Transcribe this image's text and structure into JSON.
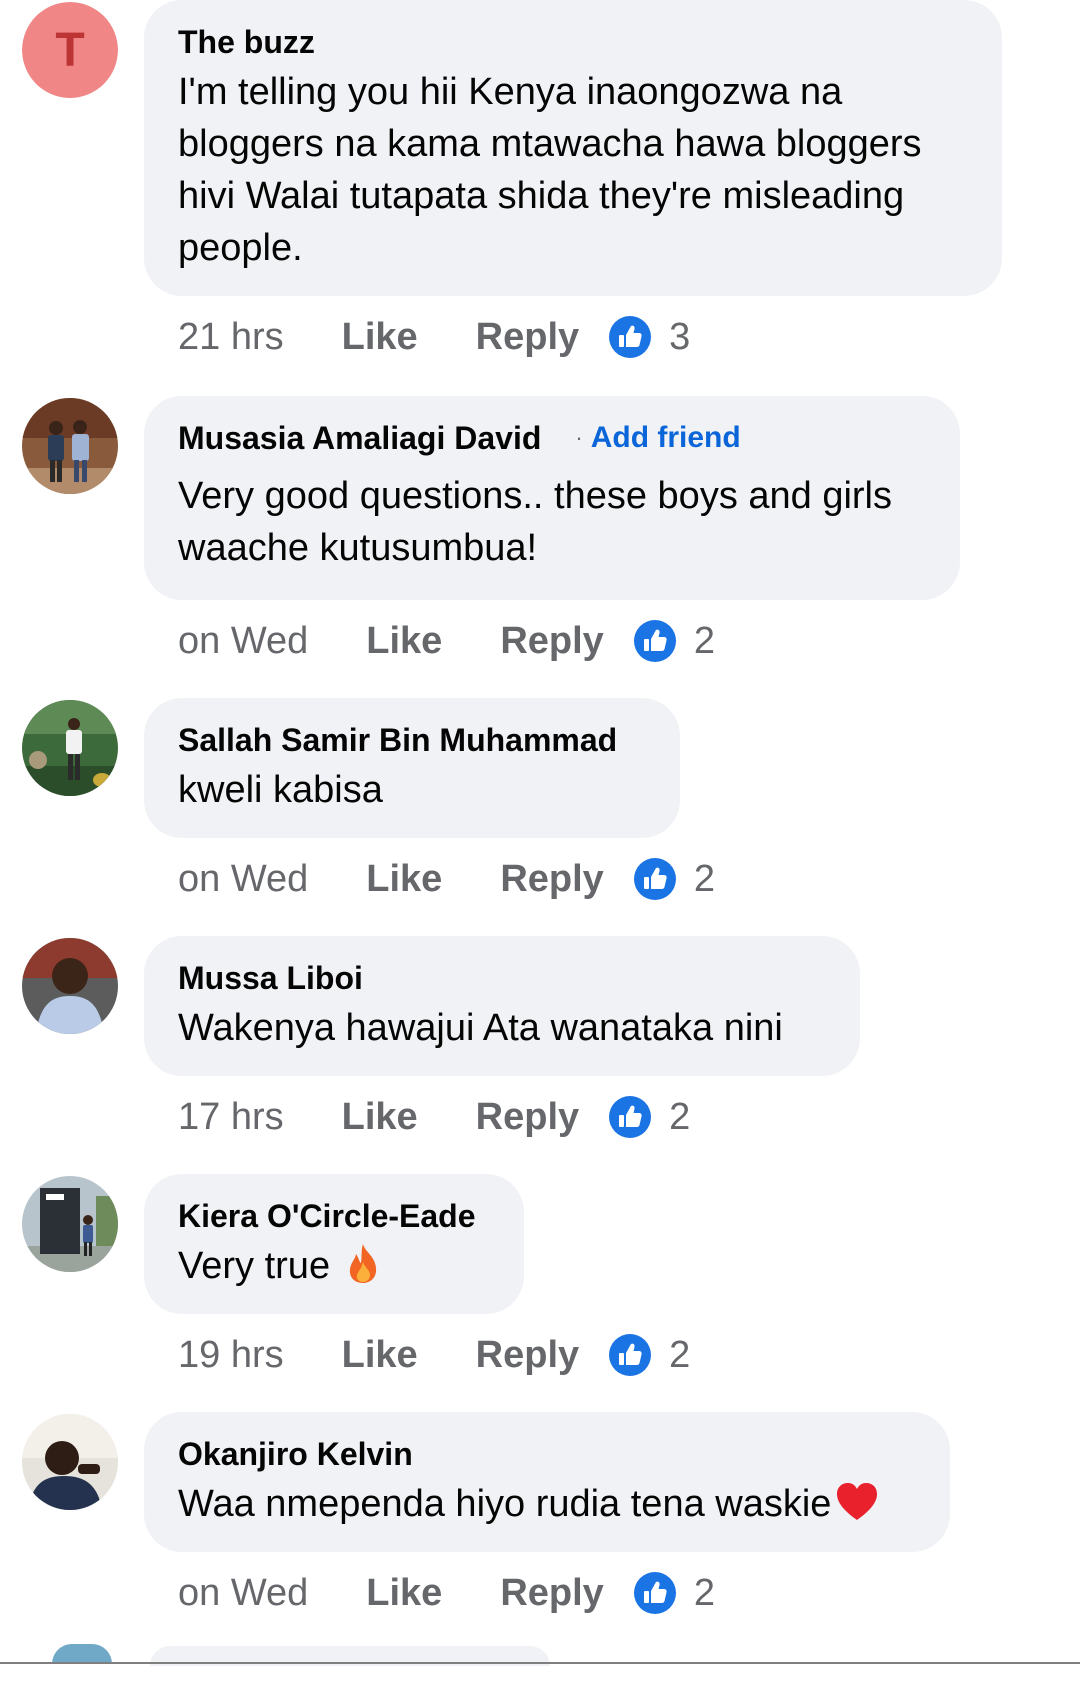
{
  "comments": [
    {
      "avatar": {
        "type": "letter",
        "letter": "T",
        "bg": "#f08686"
      },
      "author": "The buzz",
      "text": "I'm telling you hii Kenya inaongozwa na\nbloggers na kama mtawacha hawa bloggers\nhivi Walai tutapata shida they're misleading\npeople.",
      "time": "21 hrs",
      "like": "Like",
      "reply": "Reply",
      "reactions": "3"
    },
    {
      "avatar": {
        "type": "photo",
        "icon": "two-men-standing-photo"
      },
      "author": "Musasia Amaliagi David",
      "separator": "·",
      "add_friend": "Add friend",
      "text": "Very good questions.. these boys and girls\nwaache kutusumbua!",
      "time": "on Wed",
      "like": "Like",
      "reply": "Reply",
      "reactions": "2"
    },
    {
      "avatar": {
        "type": "photo",
        "icon": "man-in-garden-photo"
      },
      "author": "Sallah Samir Bin Muhammad",
      "text": "kweli kabisa",
      "time": "on Wed",
      "like": "Like",
      "reply": "Reply",
      "reactions": "2"
    },
    {
      "avatar": {
        "type": "photo",
        "icon": "man-portrait-photo"
      },
      "author": "Mussa Liboi",
      "text": "Wakenya hawajui Ata wanataka nini",
      "time": "17 hrs",
      "like": "Like",
      "reply": "Reply",
      "reactions": "2"
    },
    {
      "avatar": {
        "type": "photo",
        "icon": "person-at-riu-sign-photo"
      },
      "author": "Kiera O'Circle-Eade",
      "text": "Very true ",
      "emoji": "fire-emoji",
      "time": "19 hrs",
      "like": "Like",
      "reply": "Reply",
      "reactions": "2"
    },
    {
      "avatar": {
        "type": "photo",
        "icon": "man-selfie-photo"
      },
      "author": "Okanjiro Kelvin",
      "text": "Waa nmependa hiyo rudia tena waskie",
      "emoji": "red-heart-emoji",
      "time": "on Wed",
      "like": "Like",
      "reply": "Reply",
      "reactions": "2"
    }
  ],
  "colors": {
    "bubble": "#f0f2f5",
    "meta_text": "#65676b",
    "like_badge": "#1b74e4",
    "add_friend": "#0a66d8"
  }
}
